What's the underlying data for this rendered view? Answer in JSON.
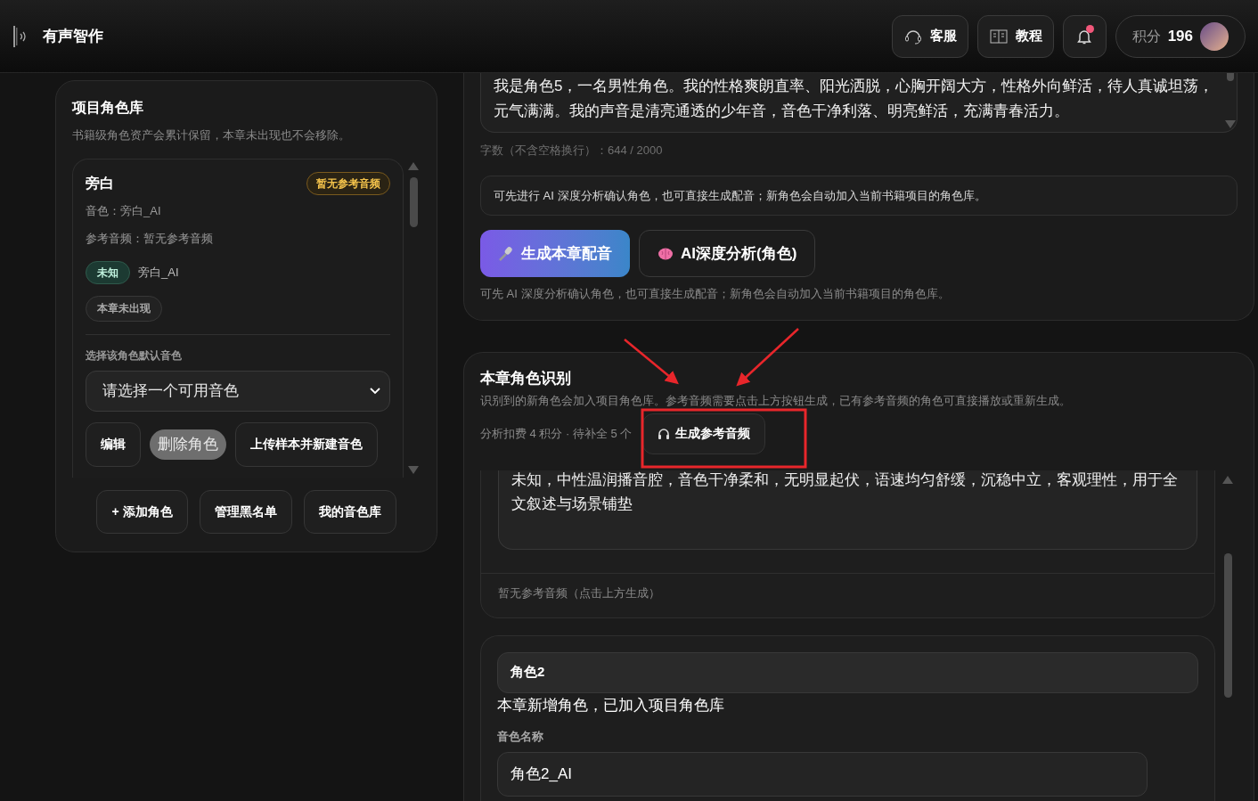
{
  "app": {
    "title": "有声智作"
  },
  "header": {
    "support_button": "客服",
    "tutorial_button": "教程",
    "notifications": {
      "unread": true
    },
    "points": {
      "label": "积分",
      "value": "196"
    }
  },
  "role_library": {
    "title": "项目角色库",
    "subtitle": "书籍级角色资产会累计保留，本章未出现也不会移除。",
    "roles": [
      {
        "name": "旁白",
        "badge": "暂无参考音频",
        "voice_line": "音色：旁白_AI",
        "reference_line": "参考音频：暂无参考音频",
        "tag": "未知",
        "tag_voice": "旁白_AI",
        "status_tag": "本章未出现",
        "select_label": "选择该角色默认音色",
        "select_placeholder": "请选择一个可用音色",
        "actions": [
          {
            "label": "编辑",
            "kind": "outline"
          },
          {
            "label": "删除角色",
            "kind": "muted"
          },
          {
            "label": "上传样本并新建音色",
            "kind": "outline"
          }
        ]
      }
    ],
    "footer_buttons": [
      "+ 添加角色",
      "管理黑名单",
      "我的音色库"
    ]
  },
  "analysis_card": {
    "text": "我是角色5，一名男性角色。我的性格爽朗直率、阳光洒脱，心胸开阔大方，性格外向鲜活，待人真诚坦荡，元气满满。我的声音是清亮通透的少年音，音色干净利落、明亮鲜活，充满青春活力。",
    "counter": "字数（不含空格换行）：644 / 2000",
    "hint": "可先进行 AI 深度分析确认角色，也可直接生成配音；新角色会自动加入当前书籍项目的角色库。",
    "primary_button": "生成本章配音",
    "secondary_button": "AI深度分析(角色)",
    "note": "可先 AI 深度分析确认角色，也可直接生成配音；新角色会自动加入当前书籍项目的角色库。"
  },
  "recognition_card": {
    "title": "本章角色识别",
    "description": "识别到的新角色会加入项目角色库。参考音频需要点击上方按钮生成，已有参考音频的角色可直接播放或重新生成。",
    "cost_text": "分析扣费 4 积分 · 待补全 5 个",
    "generate_button": "生成参考音频",
    "roles": [
      {
        "kind": "partial",
        "description": "未知，中性温润播音腔，音色干净柔和，无明显起伏，语速均匀舒缓，沉稳中立，客观理性，用于全文叙述与场景铺垫",
        "reference_status": "暂无参考音频（点击上方生成）"
      },
      {
        "kind": "full",
        "name": "角色2",
        "status": "本章新增角色，已加入项目角色库",
        "voice_label": "音色名称",
        "voice_value": "角色2_AI"
      }
    ]
  },
  "annotations": [
    {
      "kind": "arrow"
    },
    {
      "kind": "arrow"
    },
    {
      "kind": "highlight"
    }
  ]
}
